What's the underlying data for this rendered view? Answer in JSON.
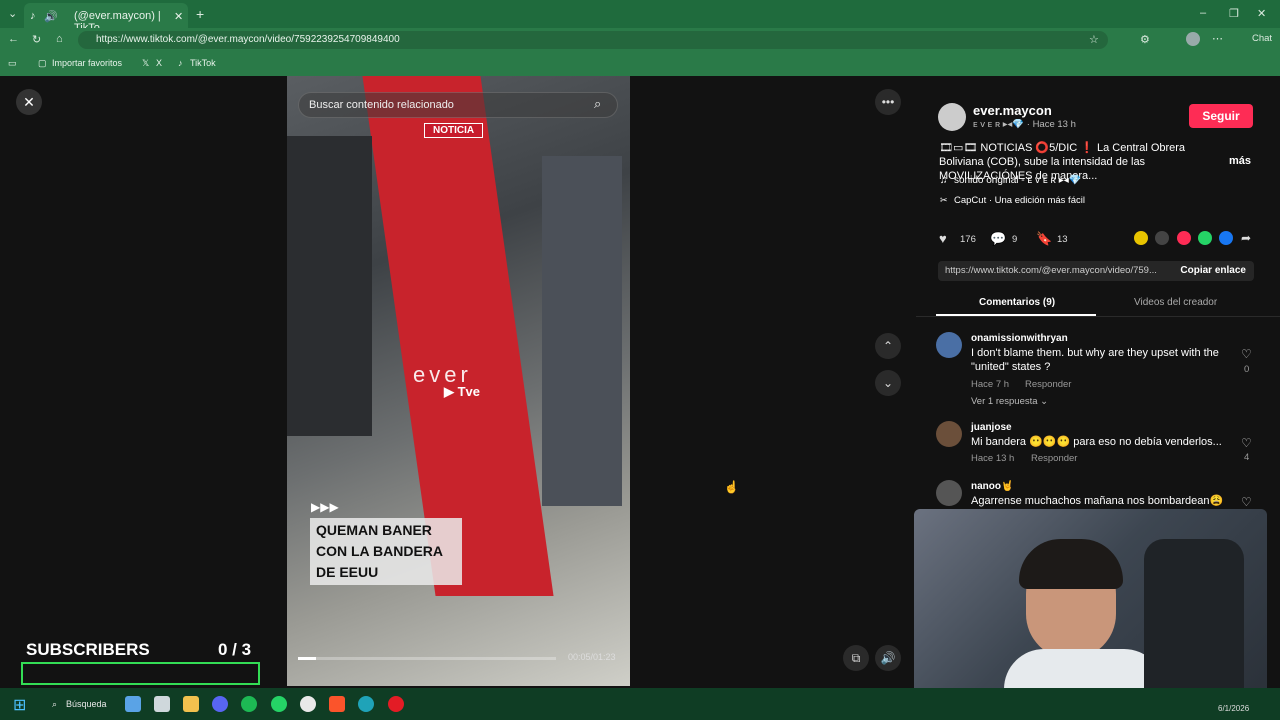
{
  "browser": {
    "tab_title": "(@ever.maycon) | TikTo",
    "url": "https://www.tiktok.com/@ever.maycon/video/7592239254709849400",
    "bookmarks": [
      "Importar favoritos",
      "X",
      "TikTok"
    ],
    "copilot_label": "Chat"
  },
  "video": {
    "search_placeholder": "Buscar contenido relacionado",
    "badge": "NOTICIA",
    "watermark": "ever",
    "watermark_sub": "Tve",
    "caption": "QUEMAN BANER CON LA BANDERA DE EEUU",
    "time": "00:05/01:23",
    "progress": 0.07,
    "arrows": "▶▶▶"
  },
  "creator": {
    "name": "ever.maycon",
    "handle_line": "ᴇ ᴠ ᴇ ʀ ▸◂💎 · Hace 13 h",
    "follow_label": "Seguir",
    "description": "🎞▭🎞 NOTICIAS ⭕5/DIC ❗ La Central Obrera Boliviana (COB), sube la intensidad de las MOVILIZACIÓNES de manera...",
    "more_label": "más",
    "sound": "sonido original - ᴇ ᴠ ᴇ ʀ ▸◂💎",
    "capcut": "CapCut · Una edición más fácil"
  },
  "stats": {
    "likes": "176",
    "comments": "9",
    "saves": "13"
  },
  "link": {
    "url": "https://www.tiktok.com/@ever.maycon/video/759...",
    "copy_label": "Copiar enlace"
  },
  "tabs": {
    "comments": "Comentarios (9)",
    "creator_videos": "Videos del creador"
  },
  "comments": [
    {
      "user": "onamissionwithryan",
      "text": "I don't blame them. but why are they upset with the \"united\" states ?",
      "time": "Hace 7 h",
      "reply": "Responder",
      "likes": "0",
      "replies": "Ver 1 respuesta"
    },
    {
      "user": "juanjose",
      "text": "Mi bandera 😶😶😶 para eso no debía venderlos...",
      "time": "Hace 13 h",
      "reply": "Responder",
      "likes": "4"
    },
    {
      "user": "nanoo🤘",
      "text": "Agarrense muchachos mañana nos bombardean😩",
      "time": "",
      "reply": "",
      "likes": ""
    }
  ],
  "overlay": {
    "subscribers_label": "SUBSCRIBERS",
    "subscribers_count": "0  / 3"
  },
  "taskbar": {
    "search_label": "Búsqueda",
    "date": "6/1/2026"
  },
  "colors": {
    "follow": "#fe2c55",
    "noticia": "#c71a2b",
    "subs_bar": "#33dd55",
    "chrome": "#2a7a48"
  }
}
